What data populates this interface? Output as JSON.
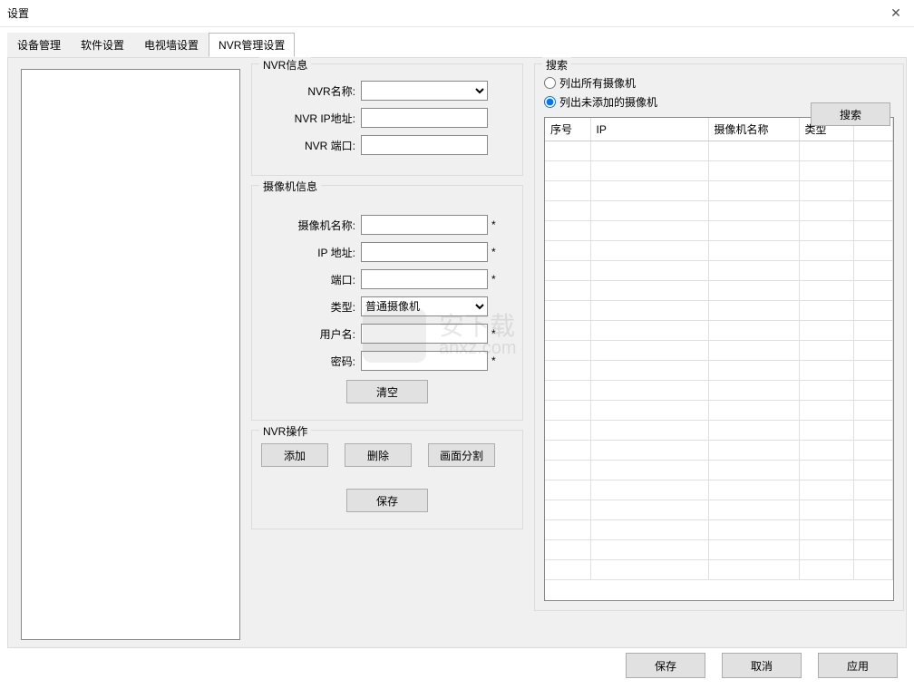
{
  "window": {
    "title": "设置"
  },
  "tabs": {
    "items": [
      {
        "label": "设备管理"
      },
      {
        "label": "软件设置"
      },
      {
        "label": "电视墙设置"
      },
      {
        "label": "NVR管理设置"
      }
    ],
    "active_index": 3
  },
  "nvr_info": {
    "legend": "NVR信息",
    "name_label": "NVR名称:",
    "name_value": "",
    "ip_label": "NVR IP地址:",
    "ip_value": "",
    "port_label": "NVR 端口:",
    "port_value": ""
  },
  "camera_info": {
    "legend": "摄像机信息",
    "name_label": "摄像机名称:",
    "name_value": "",
    "ip_label": "IP 地址:",
    "ip_value": "",
    "port_label": "端口:",
    "port_value": "",
    "type_label": "类型:",
    "type_value": "普通摄像机",
    "user_label": "用户名:",
    "user_value": "",
    "pwd_label": "密码:",
    "pwd_value": "",
    "required_mark": "*",
    "clear_btn": "清空"
  },
  "nvr_ops": {
    "legend": "NVR操作",
    "add_btn": "添加",
    "delete_btn": "删除",
    "split_btn": "画面分割",
    "save_btn": "保存"
  },
  "search": {
    "legend": "搜索",
    "radio_all": "列出所有摄像机",
    "radio_unadded": "列出未添加的摄像机",
    "selected": "unadded",
    "search_btn": "搜索",
    "columns": {
      "seq": "序号",
      "ip": "IP",
      "camera_name": "摄像机名称",
      "type": "类型"
    },
    "rows": []
  },
  "footer": {
    "save": "保存",
    "cancel": "取消",
    "apply": "应用"
  },
  "watermark": {
    "line1": "安下载",
    "line2": "anxz.com"
  }
}
